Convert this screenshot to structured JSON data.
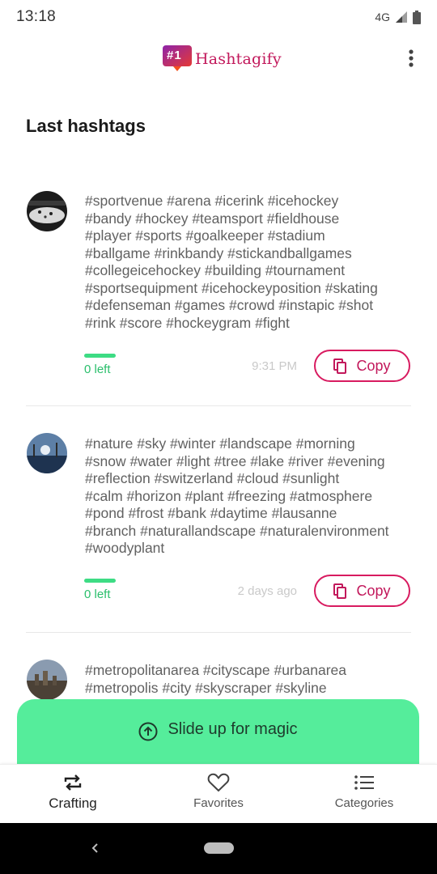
{
  "status_bar": {
    "time": "13:18",
    "network": "4G"
  },
  "app": {
    "name": "Hashtagify",
    "badge_text": "#1",
    "brand_color": "#c2185b"
  },
  "section_title": "Last hashtags",
  "cards": [
    {
      "tag_lines": [
        "#sportvenue #arena #icerink #icehockey",
        "#bandy #hockey #teamsport #fieldhouse",
        "#player #sports #goalkeeper #stadium",
        "#ballgame #rinkbandy #stickandballgames",
        "#collegeicehockey #building #tournament",
        "#sportsequipment #icehockeyposition #skating",
        "#defenseman #games #crowd #instapic #shot",
        "#rink #score #hockeygram #fight"
      ],
      "left_label": "0 left",
      "time": "9:31 PM",
      "copy_label": "Copy"
    },
    {
      "tag_lines": [
        "#nature #sky #winter #landscape #morning",
        "#snow #water #light #tree #lake #river #evening",
        "#reflection #switzerland #cloud #sunlight",
        "#calm #horizon #plant #freezing #atmosphere",
        "#pond #frost #bank #daytime #lausanne",
        "#branch #naturallandscape #naturalenvironment",
        "#woodyplant"
      ],
      "left_label": "0 left",
      "time": "2 days ago",
      "copy_label": "Copy"
    },
    {
      "tag_lines": [
        "#metropolitanarea #cityscape #urbanarea",
        "#metropolis #city #skyscraper #skyline"
      ]
    }
  ],
  "slide_up": {
    "label": "Slide up for magic",
    "color": "#55ed9b"
  },
  "bottom_nav": [
    {
      "label": "Crafting",
      "icon": "repeat-icon",
      "active": true
    },
    {
      "label": "Favorites",
      "icon": "heart-icon",
      "active": false
    },
    {
      "label": "Categories",
      "icon": "list-icon",
      "active": false
    }
  ]
}
